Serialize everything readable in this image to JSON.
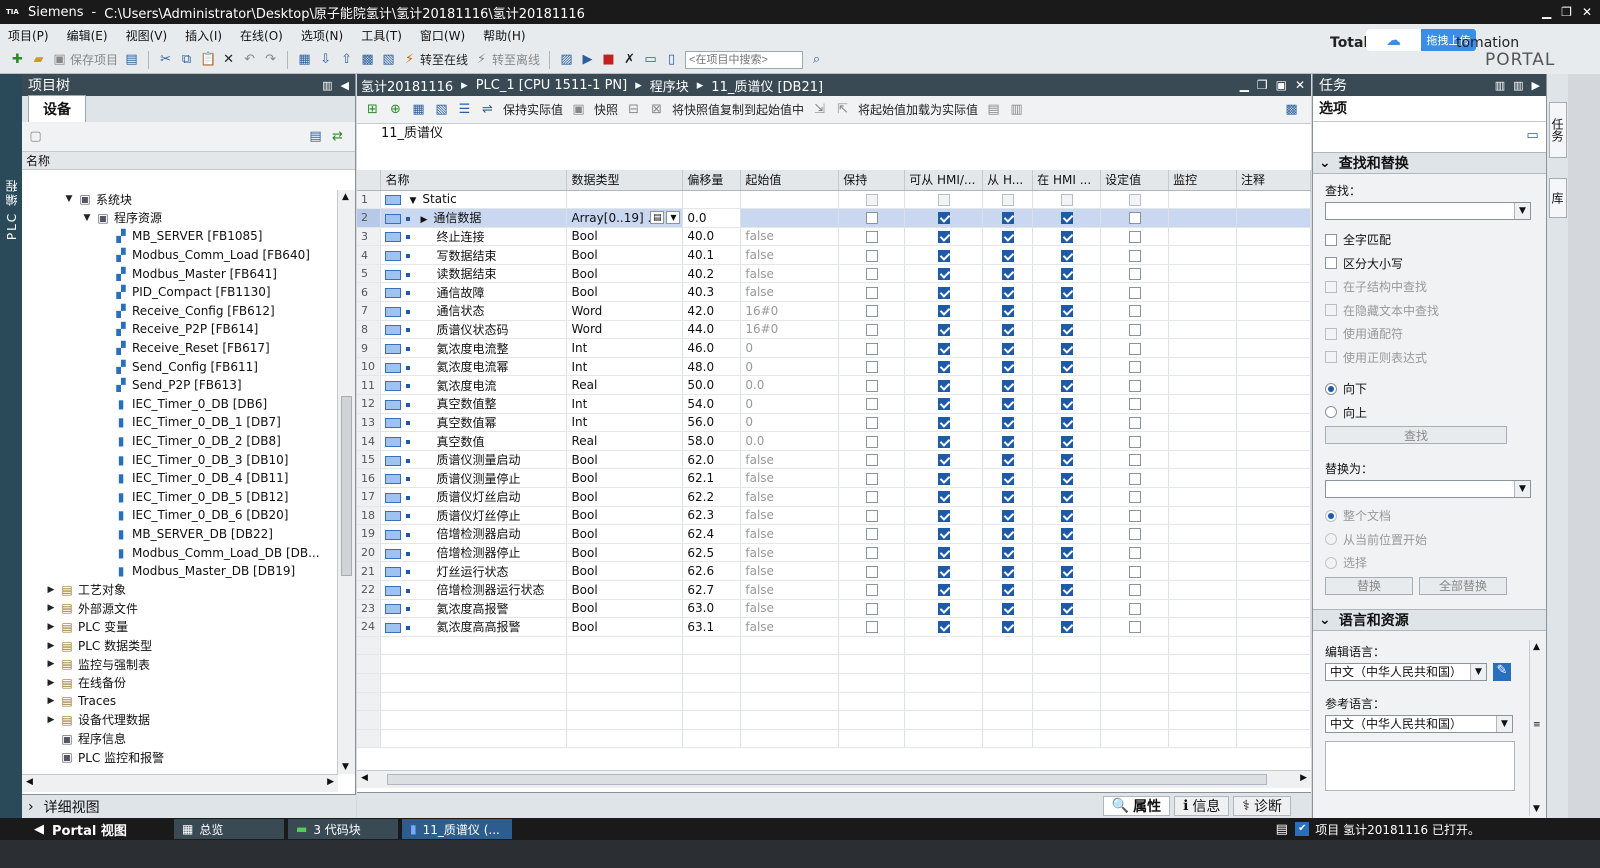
{
  "titlebar": {
    "app": "Siemens",
    "path": "C:\\Users\\Administrator\\Desktop\\原子能院氢计\\氢计20181116\\氢计20181116",
    "logo": "TIA"
  },
  "menu": [
    "项目(P)",
    "编辑(E)",
    "视图(V)",
    "插入(I)",
    "在线(O)",
    "选项(N)",
    "工具(T)",
    "窗口(W)",
    "帮助(H)"
  ],
  "toolbar": {
    "save_project": "保存项目",
    "go_online": "转至在线",
    "go_offline": "转至离线",
    "search_placeholder": "<在项目中搜索>"
  },
  "brand": {
    "line1_left": "Total",
    "line1_right": "tomation",
    "line2": "PORTAL",
    "upload": "拖拽上传"
  },
  "left_vtab": "PLC 编程",
  "project_tree": {
    "title": "项目树",
    "tab": "设备",
    "column": "名称",
    "items": [
      {
        "label": "系统块",
        "level": 2,
        "icon": "sys",
        "arrow": "▼"
      },
      {
        "label": "程序资源",
        "level": 3,
        "icon": "sys",
        "arrow": "▼"
      },
      {
        "label": "MB_SERVER [FB1085]",
        "level": 4,
        "icon": "fb",
        "arrow": ""
      },
      {
        "label": "Modbus_Comm_Load [FB640]",
        "level": 4,
        "icon": "fb",
        "arrow": ""
      },
      {
        "label": "Modbus_Master [FB641]",
        "level": 4,
        "icon": "fb",
        "arrow": ""
      },
      {
        "label": "PID_Compact [FB1130]",
        "level": 4,
        "icon": "fb",
        "arrow": ""
      },
      {
        "label": "Receive_Config [FB612]",
        "level": 4,
        "icon": "fb",
        "arrow": ""
      },
      {
        "label": "Receive_P2P [FB614]",
        "level": 4,
        "icon": "fb",
        "arrow": ""
      },
      {
        "label": "Receive_Reset [FB617]",
        "level": 4,
        "icon": "fb",
        "arrow": ""
      },
      {
        "label": "Send_Config [FB611]",
        "level": 4,
        "icon": "fb",
        "arrow": ""
      },
      {
        "label": "Send_P2P [FB613]",
        "level": 4,
        "icon": "fb",
        "arrow": ""
      },
      {
        "label": "IEC_Timer_0_DB [DB6]",
        "level": 4,
        "icon": "db",
        "arrow": ""
      },
      {
        "label": "IEC_Timer_0_DB_1 [DB7]",
        "level": 4,
        "icon": "db",
        "arrow": ""
      },
      {
        "label": "IEC_Timer_0_DB_2 [DB8]",
        "level": 4,
        "icon": "db",
        "arrow": ""
      },
      {
        "label": "IEC_Timer_0_DB_3 [DB10]",
        "level": 4,
        "icon": "db",
        "arrow": ""
      },
      {
        "label": "IEC_Timer_0_DB_4 [DB11]",
        "level": 4,
        "icon": "db",
        "arrow": ""
      },
      {
        "label": "IEC_Timer_0_DB_5 [DB12]",
        "level": 4,
        "icon": "db",
        "arrow": ""
      },
      {
        "label": "IEC_Timer_0_DB_6 [DB20]",
        "level": 4,
        "icon": "db",
        "arrow": ""
      },
      {
        "label": "MB_SERVER_DB [DB22]",
        "level": 4,
        "icon": "db",
        "arrow": ""
      },
      {
        "label": "Modbus_Comm_Load_DB [DB...",
        "level": 4,
        "icon": "db",
        "arrow": ""
      },
      {
        "label": "Modbus_Master_DB [DB19]",
        "level": 4,
        "icon": "db",
        "arrow": ""
      },
      {
        "label": "工艺对象",
        "level": 1,
        "icon": "fold",
        "arrow": "▶"
      },
      {
        "label": "外部源文件",
        "level": 1,
        "icon": "fold",
        "arrow": "▶"
      },
      {
        "label": "PLC 变量",
        "level": 1,
        "icon": "fold",
        "arrow": "▶"
      },
      {
        "label": "PLC 数据类型",
        "level": 1,
        "icon": "fold",
        "arrow": "▶"
      },
      {
        "label": "监控与强制表",
        "level": 1,
        "icon": "fold",
        "arrow": "▶"
      },
      {
        "label": "在线备份",
        "level": 1,
        "icon": "fold",
        "arrow": "▶"
      },
      {
        "label": "Traces",
        "level": 1,
        "icon": "fold",
        "arrow": "▶"
      },
      {
        "label": "设备代理数据",
        "level": 1,
        "icon": "fold",
        "arrow": "▶"
      },
      {
        "label": "程序信息",
        "level": 1,
        "icon": "sys",
        "arrow": ""
      },
      {
        "label": "PLC 监控和报警",
        "level": 1,
        "icon": "sys",
        "arrow": ""
      }
    ],
    "detail": "详细视图"
  },
  "editor": {
    "breadcrumb": [
      "氢计20181116",
      "PLC_1 [CPU 1511-1 PN]",
      "程序块",
      "11_质谱仪 [DB21]"
    ],
    "toolbar": {
      "keep_actual": "保持实际值",
      "snapshot": "快照",
      "copy_snapshot": "将快照值复制到起始值中",
      "load_start": "将起始值加载为实际值"
    },
    "block_name": "11_质谱仪",
    "columns": [
      "",
      "名称",
      "数据类型",
      "偏移量",
      "起始值",
      "保持",
      "可从 HMI/...",
      "从 H...",
      "在 HMI ...",
      "设定值",
      "监控",
      "注释"
    ],
    "rows": [
      {
        "n": "1",
        "name": "Static",
        "type": "",
        "offset": "",
        "start": "",
        "retain": false,
        "hmi1": false,
        "hmi2": false,
        "hmi3": false,
        "set": false,
        "static": true
      },
      {
        "n": "2",
        "name": "通信数据",
        "type": "Array[0..19] ...",
        "offset": "0.0",
        "start": "",
        "retain": false,
        "hmi1": true,
        "hmi2": true,
        "hmi3": true,
        "set": false,
        "sel": true
      },
      {
        "n": "3",
        "name": "终止连接",
        "type": "Bool",
        "offset": "40.0",
        "start": "false",
        "retain": false,
        "hmi1": true,
        "hmi2": true,
        "hmi3": true,
        "set": false
      },
      {
        "n": "4",
        "name": "写数据结束",
        "type": "Bool",
        "offset": "40.1",
        "start": "false",
        "retain": false,
        "hmi1": true,
        "hmi2": true,
        "hmi3": true,
        "set": false
      },
      {
        "n": "5",
        "name": "读数据结束",
        "type": "Bool",
        "offset": "40.2",
        "start": "false",
        "retain": false,
        "hmi1": true,
        "hmi2": true,
        "hmi3": true,
        "set": false
      },
      {
        "n": "6",
        "name": "通信故障",
        "type": "Bool",
        "offset": "40.3",
        "start": "false",
        "retain": false,
        "hmi1": true,
        "hmi2": true,
        "hmi3": true,
        "set": false
      },
      {
        "n": "7",
        "name": "通信状态",
        "type": "Word",
        "offset": "42.0",
        "start": "16#0",
        "retain": false,
        "hmi1": true,
        "hmi2": true,
        "hmi3": true,
        "set": false
      },
      {
        "n": "8",
        "name": "质谱仪状态码",
        "type": "Word",
        "offset": "44.0",
        "start": "16#0",
        "retain": false,
        "hmi1": true,
        "hmi2": true,
        "hmi3": true,
        "set": false
      },
      {
        "n": "9",
        "name": "氦浓度电流整",
        "type": "Int",
        "offset": "46.0",
        "start": "0",
        "retain": false,
        "hmi1": true,
        "hmi2": true,
        "hmi3": true,
        "set": false
      },
      {
        "n": "10",
        "name": "氦浓度电流幂",
        "type": "Int",
        "offset": "48.0",
        "start": "0",
        "retain": false,
        "hmi1": true,
        "hmi2": true,
        "hmi3": true,
        "set": false
      },
      {
        "n": "11",
        "name": "氦浓度电流",
        "type": "Real",
        "offset": "50.0",
        "start": "0.0",
        "retain": false,
        "hmi1": true,
        "hmi2": true,
        "hmi3": true,
        "set": false
      },
      {
        "n": "12",
        "name": "真空数值整",
        "type": "Int",
        "offset": "54.0",
        "start": "0",
        "retain": false,
        "hmi1": true,
        "hmi2": true,
        "hmi3": true,
        "set": false
      },
      {
        "n": "13",
        "name": "真空数值幂",
        "type": "Int",
        "offset": "56.0",
        "start": "0",
        "retain": false,
        "hmi1": true,
        "hmi2": true,
        "hmi3": true,
        "set": false
      },
      {
        "n": "14",
        "name": "真空数值",
        "type": "Real",
        "offset": "58.0",
        "start": "0.0",
        "retain": false,
        "hmi1": true,
        "hmi2": true,
        "hmi3": true,
        "set": false
      },
      {
        "n": "15",
        "name": "质谱仪测量启动",
        "type": "Bool",
        "offset": "62.0",
        "start": "false",
        "retain": false,
        "hmi1": true,
        "hmi2": true,
        "hmi3": true,
        "set": false
      },
      {
        "n": "16",
        "name": "质谱仪测量停止",
        "type": "Bool",
        "offset": "62.1",
        "start": "false",
        "retain": false,
        "hmi1": true,
        "hmi2": true,
        "hmi3": true,
        "set": false
      },
      {
        "n": "17",
        "name": "质谱仪灯丝启动",
        "type": "Bool",
        "offset": "62.2",
        "start": "false",
        "retain": false,
        "hmi1": true,
        "hmi2": true,
        "hmi3": true,
        "set": false
      },
      {
        "n": "18",
        "name": "质谱仪灯丝停止",
        "type": "Bool",
        "offset": "62.3",
        "start": "false",
        "retain": false,
        "hmi1": true,
        "hmi2": true,
        "hmi3": true,
        "set": false
      },
      {
        "n": "19",
        "name": "倍增检测器启动",
        "type": "Bool",
        "offset": "62.4",
        "start": "false",
        "retain": false,
        "hmi1": true,
        "hmi2": true,
        "hmi3": true,
        "set": false
      },
      {
        "n": "20",
        "name": "倍增检测器停止",
        "type": "Bool",
        "offset": "62.5",
        "start": "false",
        "retain": false,
        "hmi1": true,
        "hmi2": true,
        "hmi3": true,
        "set": false
      },
      {
        "n": "21",
        "name": "灯丝运行状态",
        "type": "Bool",
        "offset": "62.6",
        "start": "false",
        "retain": false,
        "hmi1": true,
        "hmi2": true,
        "hmi3": true,
        "set": false
      },
      {
        "n": "22",
        "name": "倍增检测器运行状态",
        "type": "Bool",
        "offset": "62.7",
        "start": "false",
        "retain": false,
        "hmi1": true,
        "hmi2": true,
        "hmi3": true,
        "set": false
      },
      {
        "n": "23",
        "name": "氦浓度高报警",
        "type": "Bool",
        "offset": "63.0",
        "start": "false",
        "retain": false,
        "hmi1": true,
        "hmi2": true,
        "hmi3": true,
        "set": false
      },
      {
        "n": "24",
        "name": "氦浓度高高报警",
        "type": "Bool",
        "offset": "63.1",
        "start": "false",
        "retain": false,
        "hmi1": true,
        "hmi2": true,
        "hmi3": true,
        "set": false
      }
    ],
    "props_tabs": [
      "属性",
      "信息",
      "诊断"
    ]
  },
  "tasks": {
    "title": "任务",
    "subtitle": "选项",
    "find_replace": "查找和替换",
    "find_label": "查找：",
    "options": [
      {
        "label": "全字匹配",
        "enabled": true
      },
      {
        "label": "区分大小写",
        "enabled": true
      },
      {
        "label": "在子结构中查找",
        "enabled": false
      },
      {
        "label": "在隐藏文本中查找",
        "enabled": false
      },
      {
        "label": "使用通配符",
        "enabled": false
      },
      {
        "label": "使用正则表达式",
        "enabled": false
      }
    ],
    "direction": [
      {
        "label": "向下",
        "on": true
      },
      {
        "label": "向上",
        "on": false
      }
    ],
    "find_btn": "查找",
    "replace_label": "替换为：",
    "scope": [
      {
        "label": "整个文档",
        "on": true
      },
      {
        "label": "从当前位置开始",
        "on": false
      },
      {
        "label": "选择",
        "on": false
      }
    ],
    "replace_btn": "替换",
    "replace_all_btn": "全部替换",
    "lang_section": "语言和资源",
    "edit_lang_label": "编辑语言：",
    "edit_lang": "中文（中华人民共和国）",
    "ref_lang_label": "参考语言：",
    "ref_lang": "中文（中华人民共和国）"
  },
  "right_vtabs": [
    "任务",
    "库"
  ],
  "status": {
    "portal": "Portal 视图",
    "tabs": [
      "总览",
      "3 代码块",
      "11_质谱仪 (..."
    ],
    "message": "项目 氢计20181116 已打开。"
  }
}
